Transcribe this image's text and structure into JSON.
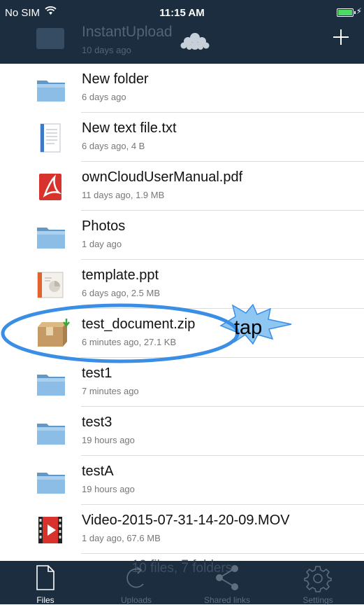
{
  "status_bar": {
    "carrier": "No SIM",
    "time": "11:15 AM"
  },
  "header": {
    "hidden_item": {
      "name": "InstantUpload",
      "date": "10 days ago"
    },
    "add_icon": "plus-icon",
    "logo_icon": "cloud-logo-icon"
  },
  "files": [
    {
      "name": "New folder",
      "meta": "6 days ago",
      "icon": "folder-icon"
    },
    {
      "name": "New text file.txt",
      "meta": "6 days ago, 4 B",
      "icon": "text-file-icon"
    },
    {
      "name": "ownCloudUserManual.pdf",
      "meta": "11 days ago, 1.9 MB",
      "icon": "pdf-file-icon"
    },
    {
      "name": "Photos",
      "meta": "1 day ago",
      "icon": "folder-icon"
    },
    {
      "name": "template.ppt",
      "meta": "6 days ago, 2.5 MB",
      "icon": "presentation-file-icon"
    },
    {
      "name": "test_document.zip",
      "meta": "6 minutes ago, 27.1 KB",
      "icon": "zip-file-icon"
    },
    {
      "name": "test1",
      "meta": "7 minutes ago",
      "icon": "folder-icon"
    },
    {
      "name": "test3",
      "meta": "19 hours ago",
      "icon": "folder-icon"
    },
    {
      "name": "testA",
      "meta": "19 hours ago",
      "icon": "folder-icon"
    },
    {
      "name": "Video-2015-07-31-14-20-09.MOV",
      "meta": "1 day ago, 67.6 MB",
      "icon": "video-file-icon"
    }
  ],
  "annotation": {
    "label": "tap"
  },
  "footer": {
    "summary": "10 files, 7 folders"
  },
  "tabbar": {
    "tabs": [
      {
        "label": "Files",
        "icon": "files-icon",
        "active": true
      },
      {
        "label": "Uploads",
        "icon": "uploads-icon",
        "active": false
      },
      {
        "label": "Shared links",
        "icon": "share-icon",
        "active": false
      },
      {
        "label": "Settings",
        "icon": "settings-gear-icon",
        "active": false
      }
    ]
  },
  "colors": {
    "bar": "#1c2d3f",
    "tap_ring": "#3a8ee6",
    "burst": "#8ec7f2",
    "battery": "#4cd964"
  }
}
